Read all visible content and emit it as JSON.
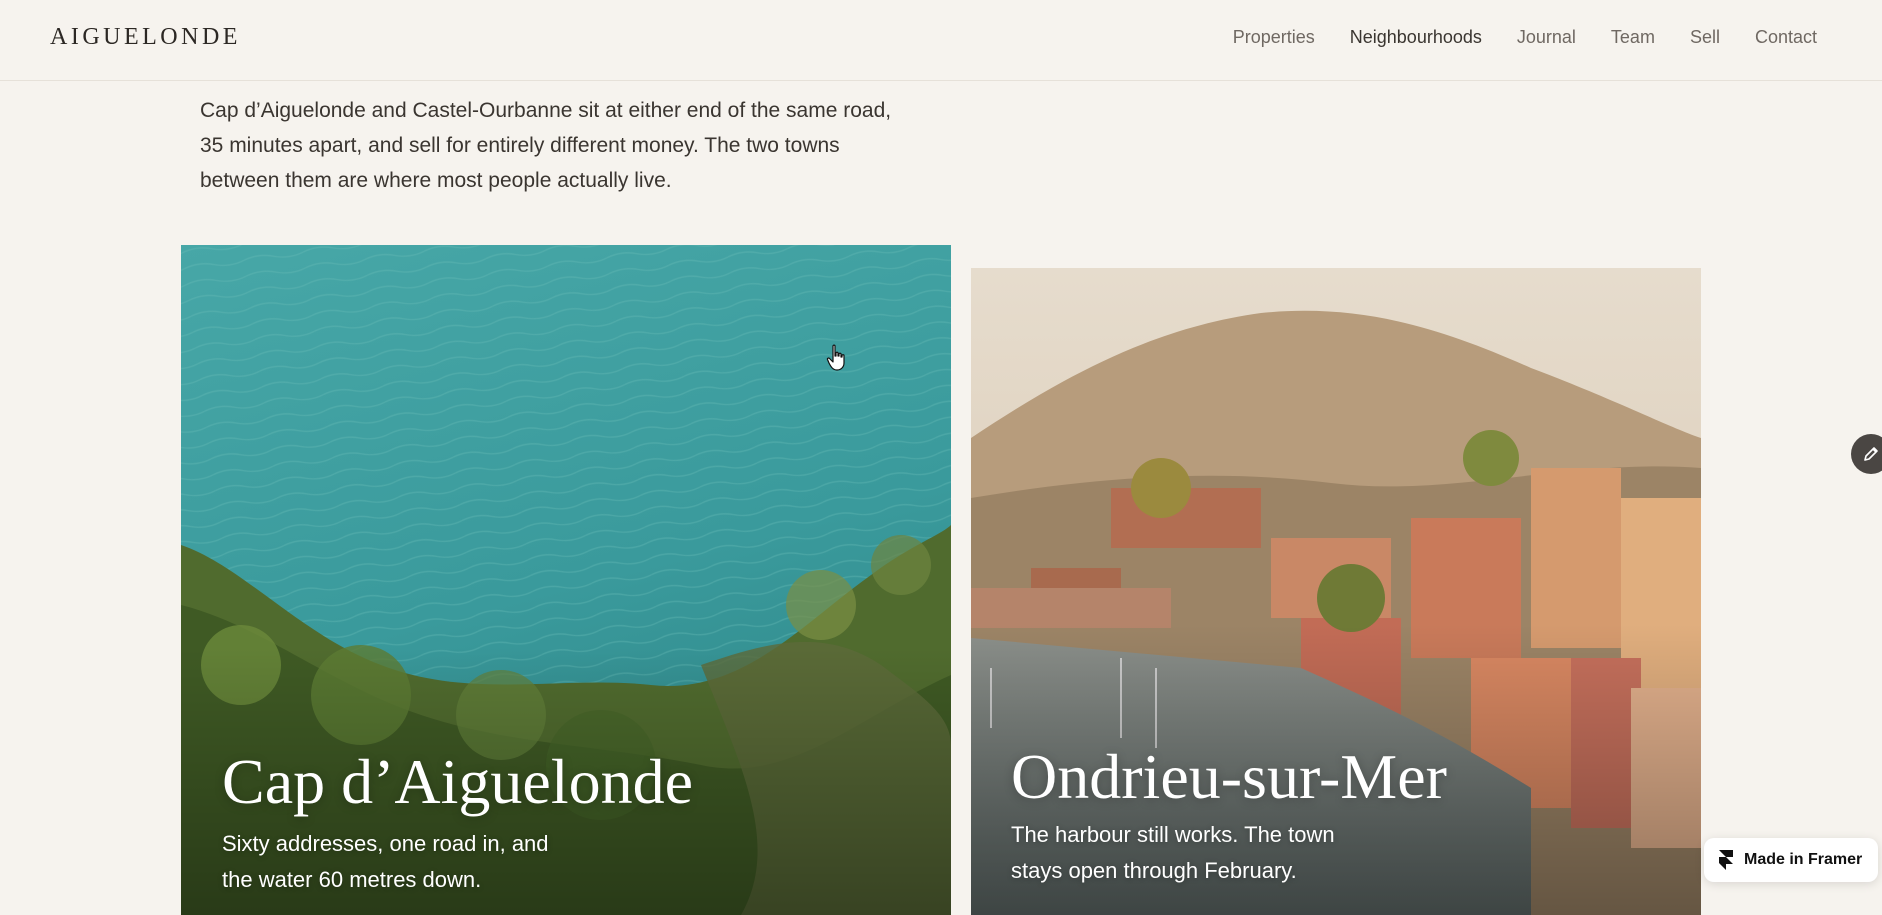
{
  "header": {
    "logo": "AIGUELONDE",
    "nav": [
      {
        "label": "Properties"
      },
      {
        "label": "Neighbourhoods"
      },
      {
        "label": "Journal"
      },
      {
        "label": "Team"
      },
      {
        "label": "Sell"
      },
      {
        "label": "Contact"
      }
    ]
  },
  "intro": {
    "text": "Cap d’Aiguelonde and Castel-Ourbanne sit at either end of the same road, 35 minutes apart, and sell for entirely different money. The two towns between them are where most people actually live."
  },
  "cards": [
    {
      "title": "Cap d’Aiguelonde",
      "description": "Sixty addresses, one road in, and the water 60 metres down."
    },
    {
      "title": "Ondrieu-sur-Mer",
      "description": "The harbour still works. The town stays open through February."
    }
  ],
  "badge": {
    "label": "Made in Framer",
    "icon": "framer-logo-icon"
  },
  "edit": {
    "icon": "pencil-icon"
  },
  "colors": {
    "background": "#f6f3ee",
    "text": "#3a3530",
    "nav_text": "#6f6862",
    "sea": "#3d9a9c",
    "foliage": "#4f6a2c"
  }
}
